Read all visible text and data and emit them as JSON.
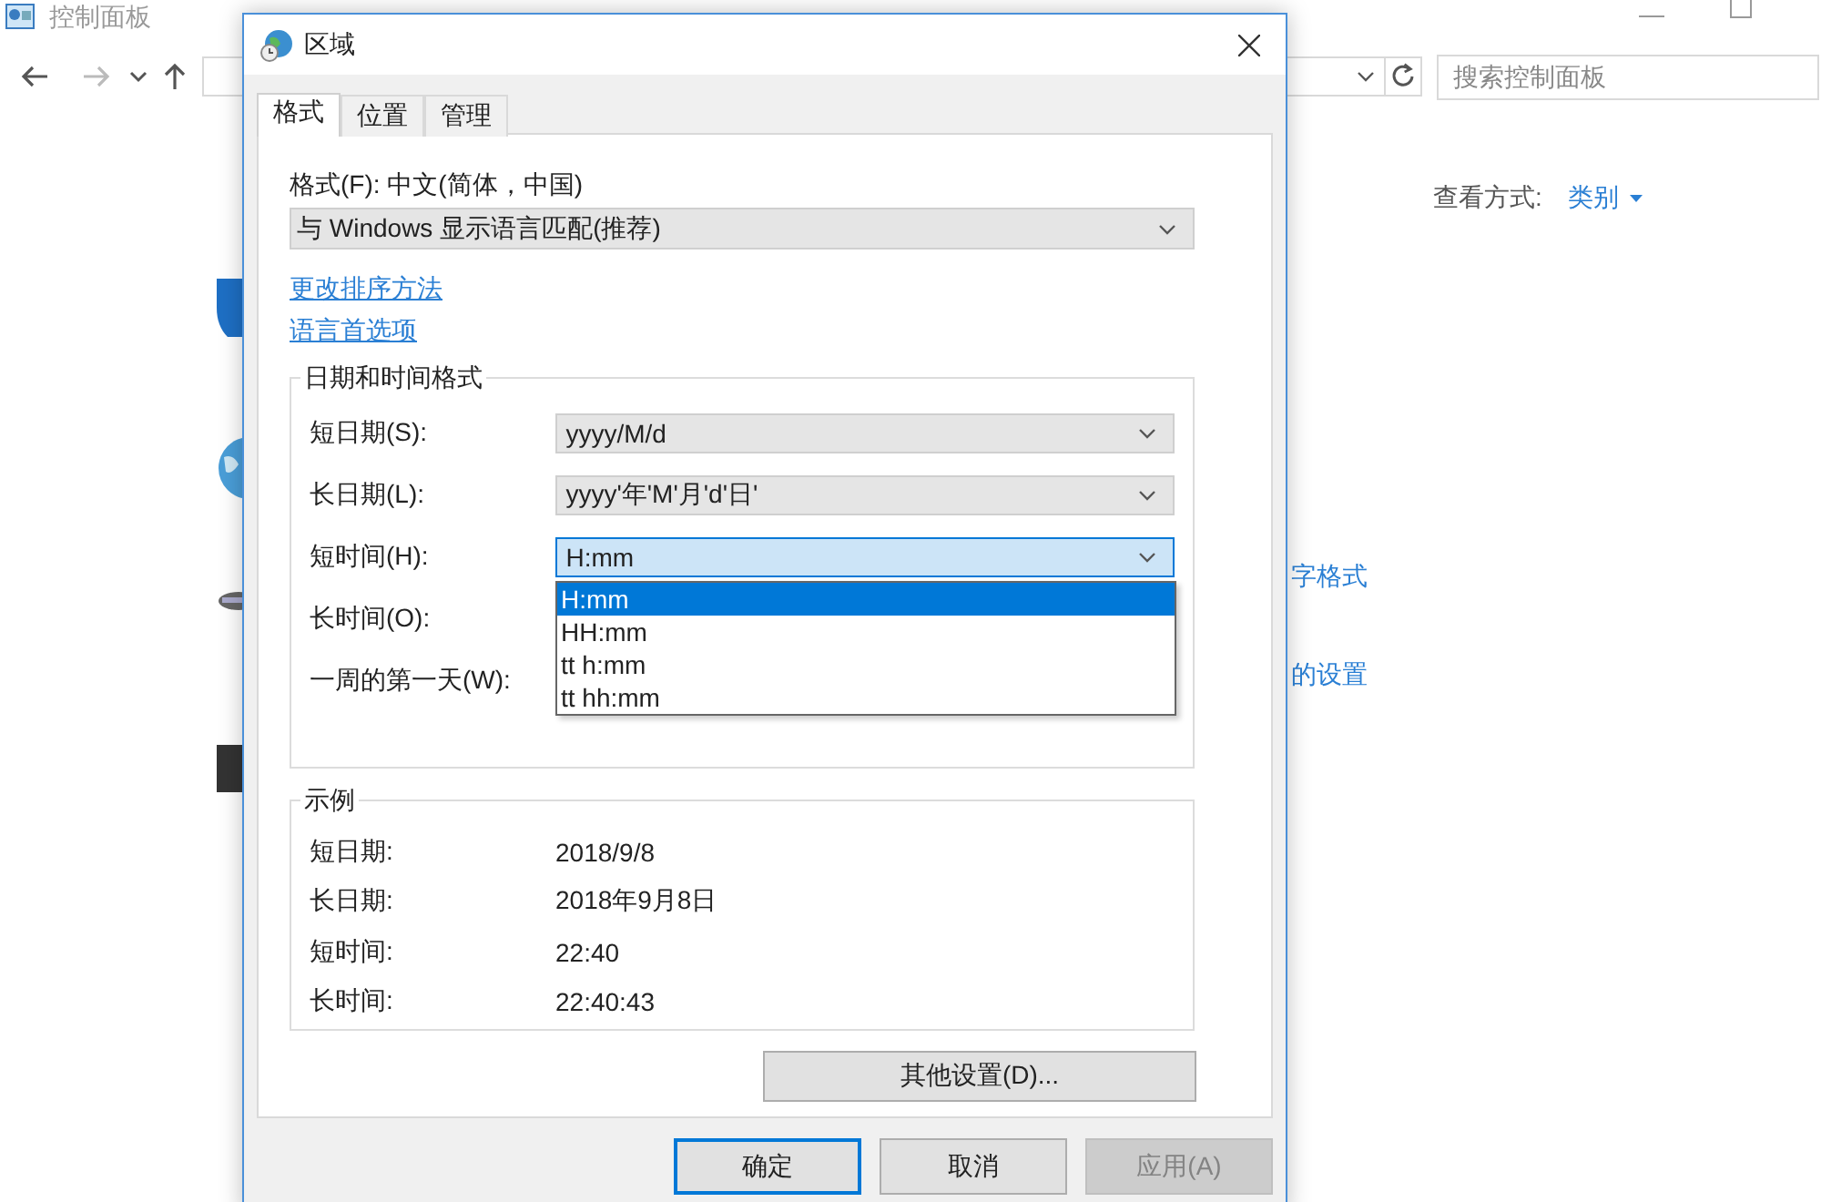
{
  "window": {
    "title": "控制面板",
    "search_placeholder": "搜索控制面板",
    "view_by_label": "查看方式:",
    "view_by_value": "类别",
    "links": [
      "字格式",
      "的设置"
    ]
  },
  "dialog": {
    "title": "区域",
    "tabs": [
      {
        "label": "格式",
        "selected": true
      },
      {
        "label": "位置",
        "selected": false
      },
      {
        "label": "管理",
        "selected": false
      }
    ],
    "format_label": "格式(F): 中文(简体，中国)",
    "format_value": "与 Windows 显示语言匹配(推荐)",
    "links": [
      "更改排序方法",
      "语言首选项"
    ],
    "datetime_group": {
      "title": "日期和时间格式",
      "fields": [
        {
          "label": "短日期(S):",
          "value": "yyyy/M/d",
          "expanded": false
        },
        {
          "label": "长日期(L):",
          "value": "yyyy'年'M'月'd'日'",
          "expanded": false
        },
        {
          "label": "短时间(H):",
          "value": "H:mm",
          "expanded": true,
          "options": [
            {
              "text": "H:mm",
              "selected": true
            },
            {
              "text": "HH:mm",
              "selected": false
            },
            {
              "text": "tt h:mm",
              "selected": false
            },
            {
              "text": "tt hh:mm",
              "selected": false
            }
          ]
        },
        {
          "label": "长时间(O):"
        },
        {
          "label": "一周的第一天(W):"
        }
      ]
    },
    "example_group": {
      "title": "示例",
      "rows": [
        {
          "label": "短日期:",
          "value": "2018/9/8"
        },
        {
          "label": "长日期:",
          "value": "2018年9月8日"
        },
        {
          "label": "短时间:",
          "value": "22:40"
        },
        {
          "label": "长时间:",
          "value": "22:40:43"
        }
      ]
    },
    "other_settings_button": "其他设置(D)...",
    "buttons": [
      {
        "label": "确定",
        "default": true,
        "disabled": false
      },
      {
        "label": "取消",
        "default": false,
        "disabled": false
      },
      {
        "label": "应用(A)",
        "default": false,
        "disabled": true
      }
    ]
  }
}
